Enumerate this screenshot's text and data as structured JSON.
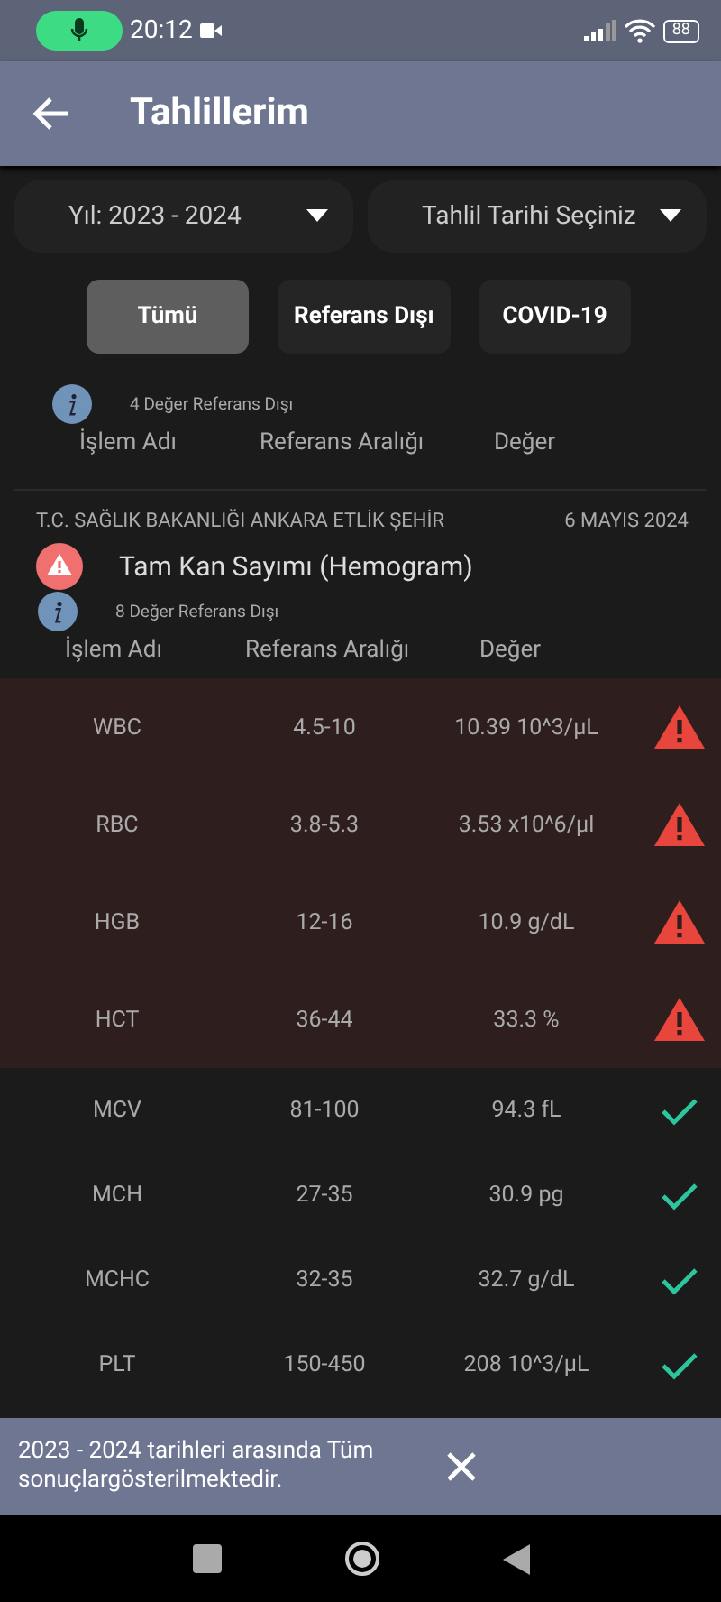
{
  "status_bar": {
    "time": "20:12",
    "battery": "88"
  },
  "app_bar": {
    "title": "Tahlillerim"
  },
  "dropdowns": [
    {
      "label": "Yıl: 2023 - 2024"
    },
    {
      "label": "Tahlil Tarihi Seçiniz"
    }
  ],
  "filters": [
    {
      "label": "Tümü",
      "selected": true
    },
    {
      "label": "Referans Dışı",
      "selected": false
    },
    {
      "label": "COVID-19",
      "selected": false
    }
  ],
  "sections": [
    {
      "out_of_range": "4 Değer Referans Dışı",
      "columns": [
        "İşlem Adı",
        "Referans Aralığı",
        "Değer"
      ]
    },
    {
      "institution": "T.C. SAĞLIK BAKANLIĞI ANKARA ETLİK ŞEHİR",
      "date": "6 MAYIS 2024",
      "test_name": "Tam Kan Sayımı (Hemogram)",
      "alert": true,
      "out_of_range": "8 Değer Referans Dışı",
      "columns": [
        "İşlem Adı",
        "Referans Aralığı",
        "Değer"
      ],
      "rows": [
        {
          "kind": "out",
          "name": "WBC",
          "range": "4.5-10",
          "value": "10.39 10^3/µL"
        },
        {
          "kind": "out",
          "name": "RBC",
          "range": "3.8-5.3",
          "value": "3.53 x10^6/µl"
        },
        {
          "kind": "out",
          "name": "HGB",
          "range": "12-16",
          "value": "10.9 g/dL"
        },
        {
          "kind": "out",
          "name": "HCT",
          "range": "36-44",
          "value": "33.3 %"
        },
        {
          "kind": "normal",
          "name": "MCV",
          "range": "81-100",
          "value": "94.3 fL"
        },
        {
          "kind": "normal",
          "name": "MCH",
          "range": "27-35",
          "value": "30.9 pg"
        },
        {
          "kind": "normal",
          "name": "MCHC",
          "range": "32-35",
          "value": "32.7 g/dL"
        },
        {
          "kind": "normal",
          "name": "PLT",
          "range": "150-450",
          "value": "208 10^3/µL"
        }
      ]
    }
  ],
  "snackbar": {
    "message": "2023 - 2024 tarihleri arasında Tüm sonuçlargösterilmektedir."
  }
}
